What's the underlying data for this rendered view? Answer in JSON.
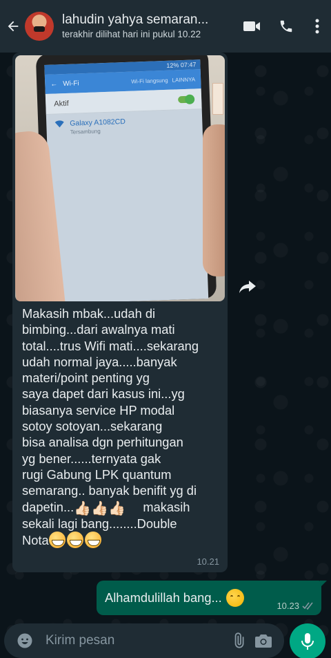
{
  "header": {
    "contact_name": "lahudin yahya semaran...",
    "last_seen": "terakhir dilihat hari ini pukul 10.22",
    "icons": [
      "back-arrow-icon",
      "video-call-icon",
      "phone-call-icon",
      "more-vert-icon"
    ]
  },
  "photo": {
    "status_time": "12% 07:47",
    "wifi_title": "Wi-Fi",
    "wifi_option": "Wi-Fi langsung",
    "wifi_option2": "LAINNYA",
    "active_label": "Aktif",
    "network_name": "Galaxy A1082CD",
    "network_state": "Tersambung"
  },
  "incoming": {
    "text": "Makasih mbak...udah di\nbimbing...dari awalnya mati\ntotal....trus Wifi mati....sekarang\nudah normal jaya.....banyak\nmateri/point penting yg\nsaya dapet dari kasus ini...yg\nbiasanya service HP modal\nsotoy sotoyan...sekarang\nbisa analisa dgn perhitungan\nyg bener......ternyata gak\nrugi Gabung LPK quantum\nsemarang.. banyak benifit yg di",
    "line_thumbs_prefix": "dapetin...",
    "line_thumbs_suffix": "makasih",
    "line_last": "sekali lagi bang........Double",
    "line_nota": "Nota",
    "time": "10.21"
  },
  "outgoing": {
    "text": "Alhamdulillah bang...",
    "time": "10.23"
  },
  "composer": {
    "placeholder": "Kirim pesan",
    "icons": [
      "emoji-icon",
      "attach-icon",
      "camera-icon",
      "mic-icon"
    ]
  },
  "colors": {
    "header_bg": "#1f2c34",
    "incoming_bg": "#1f2c34",
    "outgoing_bg": "#005c4b",
    "accent": "#00a884"
  }
}
